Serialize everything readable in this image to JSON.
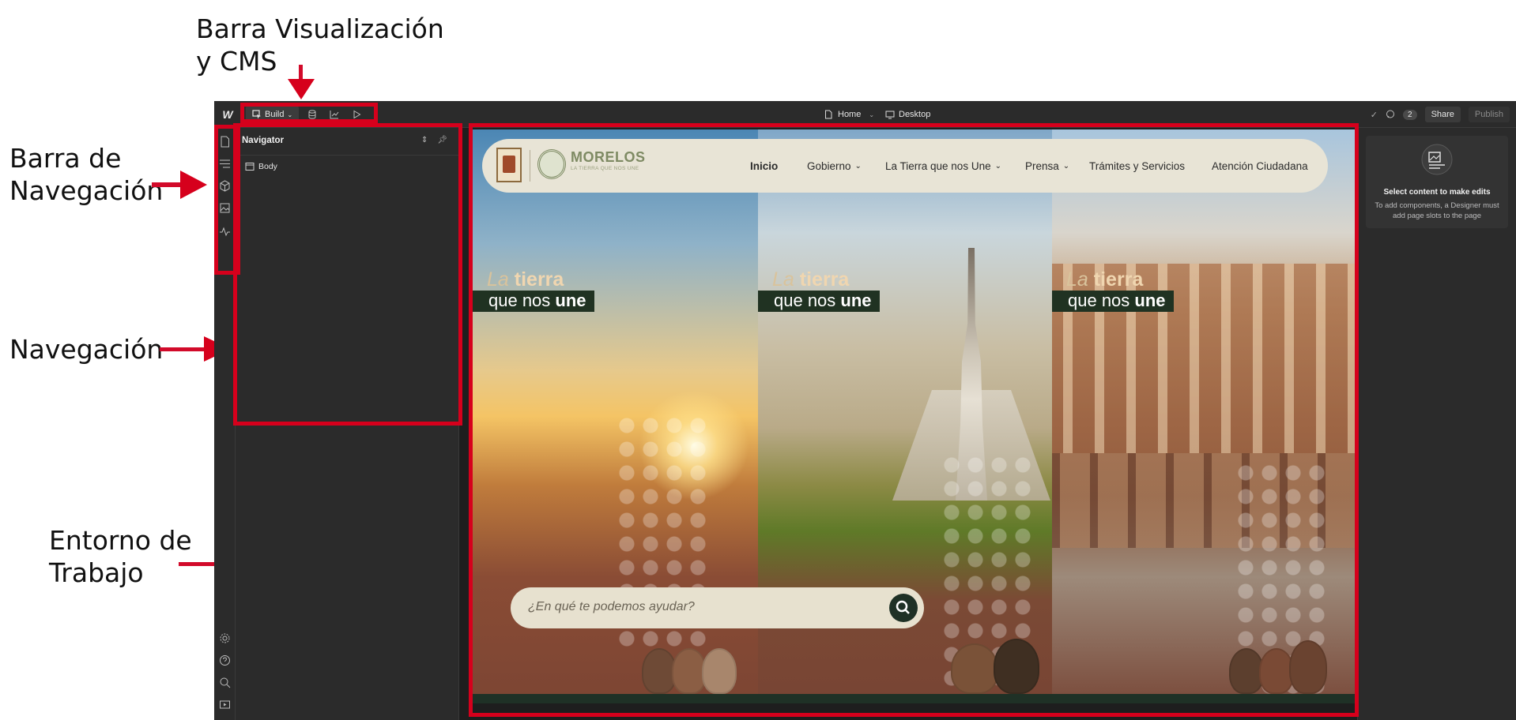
{
  "annotations": {
    "toolbar_label_line1": "Barra Visualización",
    "toolbar_label_line2": "y CMS",
    "rail_label_line1": "Barra de",
    "rail_label_line2": "Navegación",
    "nav_label": "Navegación",
    "canvas_label_line1": "Entorno de",
    "canvas_label_line2": "Trabajo",
    "annotation_color": "#d6001c"
  },
  "topbar": {
    "logo": "W",
    "build_label": "Build",
    "page_label": "Home",
    "breakpoint_label": "Desktop",
    "comment_count": "2",
    "share_label": "Share",
    "publish_label": "Publish"
  },
  "navigator": {
    "title": "Navigator",
    "items": [
      {
        "label": "Body"
      }
    ]
  },
  "right_panel": {
    "title": "Select content to make edits",
    "description": "To add components, a Designer must add page slots to the page"
  },
  "site": {
    "brand_name": "MORELOS",
    "brand_tagline": "LA TIERRA QUE NOS UNE",
    "nav": [
      {
        "label": "Inicio",
        "active": true
      },
      {
        "label": "Gobierno",
        "dropdown": true
      },
      {
        "label": "La Tierra que nos Une",
        "dropdown": true
      },
      {
        "label": "Prensa",
        "dropdown": true
      },
      {
        "label": "Trámites y Servicios"
      },
      {
        "label": "Atención Ciudadana"
      }
    ],
    "hero_word_la": "La",
    "hero_word_tierra": "tierra",
    "hero_line2_pre": "que nos",
    "hero_line2_bold": "une",
    "search_placeholder": "¿En qué te podemos ayudar?",
    "accent_color": "#1f3126"
  }
}
